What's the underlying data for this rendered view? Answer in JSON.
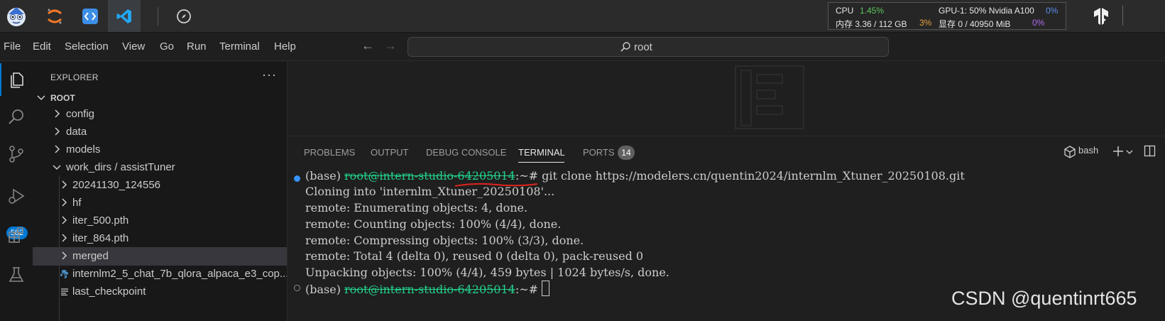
{
  "topbar": {
    "apps": [
      "mascot-app",
      "jupyter-app",
      "code-editor-app",
      "vscode-app",
      "compass-app"
    ],
    "stats": {
      "cpu_label": "CPU",
      "cpu_value": "1.45%",
      "mem_label": "内存 3.36 / 112 GB",
      "mem_pct": "3%",
      "gpu_label": "GPU-1: 50% Nvidia A100",
      "gpu_pct": "0%",
      "vram_label": "显存 0 / 40950 MiB",
      "vram_pct": "0%"
    }
  },
  "menubar": {
    "items": [
      "File",
      "Edit",
      "Selection",
      "View",
      "Go",
      "Run",
      "Terminal",
      "Help"
    ],
    "search_text": "root"
  },
  "activity": {
    "scm_badge": "582"
  },
  "explorer": {
    "title": "EXPLORER",
    "more": "···",
    "root": "ROOT",
    "items": [
      {
        "label": "config"
      },
      {
        "label": "data"
      },
      {
        "label": "models"
      },
      {
        "label": "work_dirs / assistTuner"
      },
      {
        "label": "20241130_124556"
      },
      {
        "label": "hf"
      },
      {
        "label": "iter_500.pth"
      },
      {
        "label": "iter_864.pth"
      },
      {
        "label": "merged"
      },
      {
        "label": "internlm2_5_chat_7b_qlora_alpaca_e3_cop..."
      },
      {
        "label": "last_checkpoint"
      }
    ]
  },
  "panel": {
    "tabs": [
      "PROBLEMS",
      "OUTPUT",
      "DEBUG CONSOLE",
      "TERMINAL",
      "PORTS"
    ],
    "ports_count": "14",
    "shell": "bash"
  },
  "terminal": {
    "prompt_prefix": "(base) ",
    "user_host": "root@intern-studio-64205014",
    "prompt_suffix": ":~# ",
    "command": "git clone https://modelers.cn/quentin2024/internlm_Xtuner_20250108.git",
    "output": [
      "Cloning into 'internlm_Xtuner_20250108'...",
      "remote: Enumerating objects: 4, done.",
      "remote: Counting objects: 100% (4/4), done.",
      "remote: Compressing objects: 100% (3/3), done.",
      "remote: Total 4 (delta 0), reused 0 (delta 0), pack-reused 0",
      "Unpacking objects: 100% (4/4), 459 bytes | 1024 bytes/s, done."
    ]
  },
  "watermark": "CSDN @quentinrt665",
  "colors": {
    "accent": "#0078d4",
    "prompt_user": "#23d18b",
    "success_dot": "#3794ff",
    "idle_dot": "#8b8b8b",
    "annotation_red": "#e0241f"
  }
}
